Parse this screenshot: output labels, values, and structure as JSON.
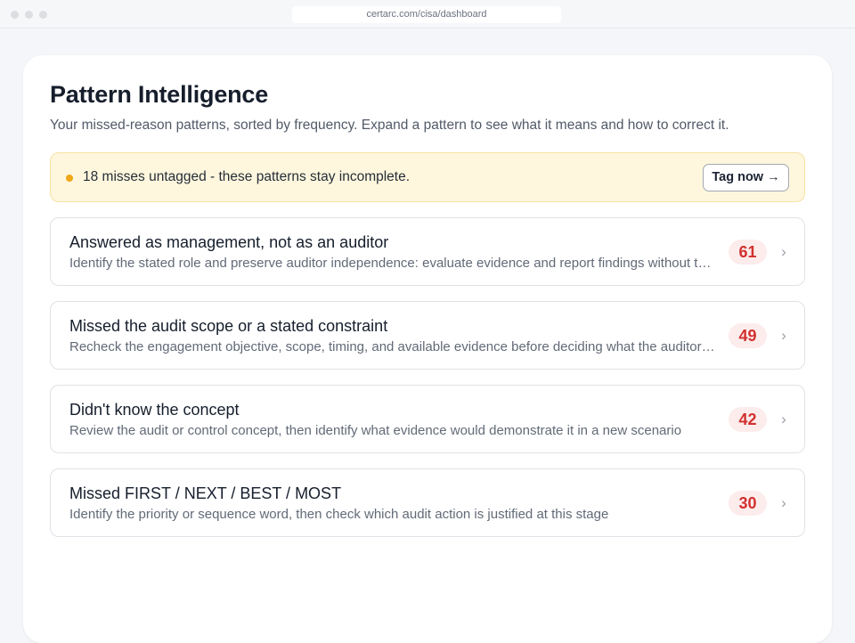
{
  "browser": {
    "url": "certarc.com/cisa/dashboard"
  },
  "header": {
    "title": "Pattern Intelligence",
    "subtitle": "Your missed-reason patterns, sorted by frequency. Expand a pattern to see what it means and how to correct it."
  },
  "banner": {
    "text": "18 misses untagged - these patterns stay incomplete.",
    "button_label": "Tag now →",
    "dot_color": "#f0a617"
  },
  "patterns": [
    {
      "title": "Answered as management, not as an auditor",
      "description": "Identify the stated role and preserve auditor independence: evaluate evidence and report findings without taking on management responsibilities",
      "count": "61"
    },
    {
      "title": "Missed the audit scope or a stated constraint",
      "description": "Recheck the engagement objective, scope, timing, and available evidence before deciding what the auditor should do",
      "count": "49"
    },
    {
      "title": "Didn't know the concept",
      "description": "Review the audit or control concept, then identify what evidence would demonstrate it in a new scenario",
      "count": "42"
    },
    {
      "title": "Missed FIRST / NEXT / BEST / MOST",
      "description": "Identify the priority or sequence word, then check which audit action is justified at this stage",
      "count": "30"
    }
  ],
  "icons": {
    "chevron": "chevron-right-icon",
    "banner_dot": "warning-dot-icon"
  },
  "colors": {
    "badge_text": "#d1312f",
    "badge_bg": "#fdecec",
    "banner_bg": "#fef7dd"
  }
}
